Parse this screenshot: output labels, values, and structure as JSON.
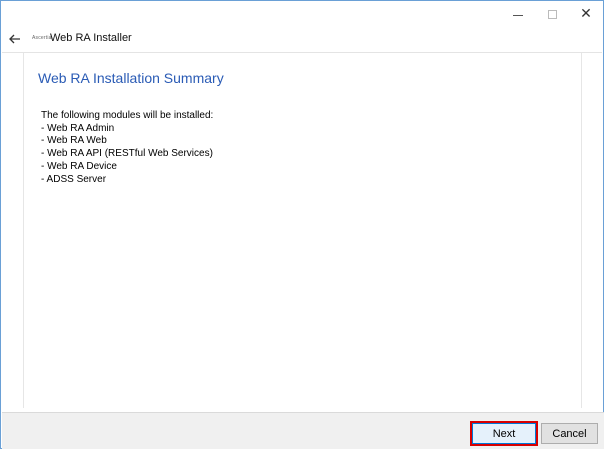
{
  "window": {
    "title": "Web RA  Installer",
    "logo_text": "Ascertia"
  },
  "caption_buttons": {
    "minimize_icon": "minimize-icon",
    "maximize_icon": "maximize-icon",
    "close_icon": "close-icon",
    "close_glyph": "✕"
  },
  "content": {
    "page_title": "Web RA Installation Summary",
    "intro": "The following modules will be installed:",
    "modules": [
      "- Web RA Admin",
      "- Web RA Web",
      "- Web RA API (RESTful Web Services)",
      "- Web RA Device",
      "- ADSS Server"
    ]
  },
  "footer": {
    "next_label": "Next",
    "cancel_label": "Cancel",
    "highlight_color": "#d80000"
  },
  "colors": {
    "title_blue": "#2a5bb5",
    "window_border": "#6aa0d6"
  }
}
